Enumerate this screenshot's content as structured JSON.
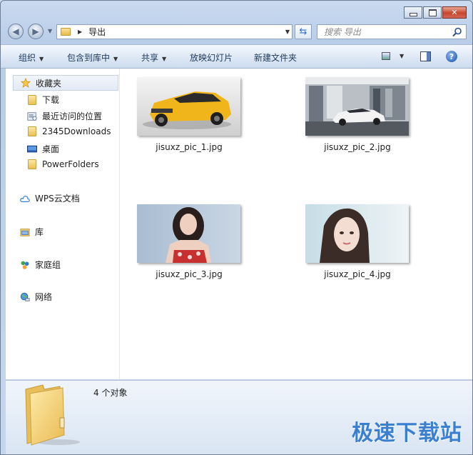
{
  "address": {
    "path": "导出",
    "search_placeholder": "搜索 导出"
  },
  "toolbar": {
    "organize": "组织",
    "include_in_library": "包含到库中",
    "share": "共享",
    "slideshow": "放映幻灯片",
    "new_folder": "新建文件夹"
  },
  "nav": {
    "favorites": "收藏夹",
    "downloads": "下载",
    "recent_places": "最近访问的位置",
    "downloads_2345": "2345Downloads",
    "desktop": "桌面",
    "powerfolders": "PowerFolders",
    "wps_cloud": "WPS云文档",
    "libraries": "库",
    "homegroup": "家庭组",
    "network": "网络"
  },
  "files": [
    {
      "name": "jisuxz_pic_1.jpg"
    },
    {
      "name": "jisuxz_pic_2.jpg"
    },
    {
      "name": "jisuxz_pic_3.jpg"
    },
    {
      "name": "jisuxz_pic_4.jpg"
    }
  ],
  "status": {
    "item_count": "4 个对象"
  },
  "watermark": "极速下载站"
}
